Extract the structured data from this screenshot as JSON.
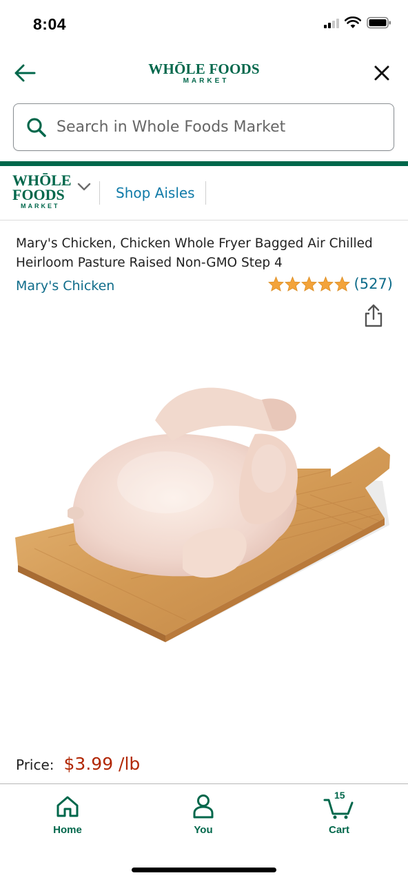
{
  "status_bar": {
    "time": "8:04"
  },
  "header": {
    "logo_main": "WHŌLE FOODS",
    "logo_sub": "MARKET"
  },
  "search": {
    "placeholder": "Search in Whole Foods Market"
  },
  "store_nav": {
    "logo_line1": "WHŌLE",
    "logo_line2": "FOODS",
    "logo_line3": "MARKET",
    "shop_aisles_label": "Shop Aisles"
  },
  "product": {
    "title": "Mary's Chicken, Chicken Whole Fryer Bagged Air Chilled Heirloom Pasture Raised Non-GMO Step 4",
    "brand": "Mary's Chicken",
    "rating_stars": 5,
    "review_count": "(527)",
    "price_label": "Price:",
    "price_value": "$3.99 /lb"
  },
  "bottom_nav": {
    "tabs": [
      {
        "label": "Home",
        "icon": "home-icon"
      },
      {
        "label": "You",
        "icon": "person-icon"
      },
      {
        "label": "Cart",
        "icon": "cart-icon",
        "count": "15"
      }
    ]
  },
  "colors": {
    "brand_green": "#00674b",
    "link_blue": "#0f7aa8",
    "price_red": "#b12704",
    "star_orange": "#f3a33a"
  }
}
